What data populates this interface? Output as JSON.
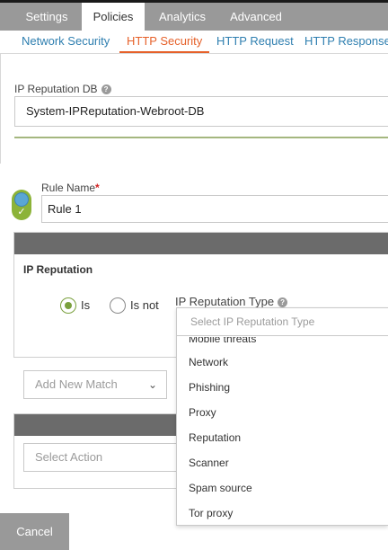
{
  "top_tabs": [
    {
      "label": "Settings",
      "active": false
    },
    {
      "label": "Policies",
      "active": true
    },
    {
      "label": "Analytics",
      "active": false
    },
    {
      "label": "Advanced",
      "active": false
    }
  ],
  "sub_tabs": [
    {
      "label": "Network Security",
      "active": false
    },
    {
      "label": "HTTP Security",
      "active": true
    },
    {
      "label": "HTTP Request",
      "active": false
    },
    {
      "label": "HTTP Response",
      "active": false
    }
  ],
  "ip_reputation_db": {
    "label": "IP Reputation DB",
    "value": "System-IPReputation-Webroot-DB"
  },
  "rule": {
    "name_label": "Rule Name",
    "required_mark": "*",
    "name_value": "Rule 1",
    "enabled": true
  },
  "ip_reputation_panel": {
    "title": "IP Reputation",
    "radio_is": "Is",
    "radio_is_not": "Is not",
    "selected": "Is",
    "type_label": "IP Reputation Type",
    "type_placeholder": "Select IP Reputation Type"
  },
  "add_new_match": {
    "placeholder": "Add New Match"
  },
  "select_action": {
    "placeholder": "Select Action"
  },
  "dropdown_options": [
    "Mobile threats",
    "Network",
    "Phishing",
    "Proxy",
    "Reputation",
    "Scanner",
    "Spam source",
    "Tor proxy"
  ],
  "footer": {
    "cancel_label": "Cancel"
  },
  "colors": {
    "accent_orange": "#e6612a",
    "link_blue": "#2f7fb0",
    "toggle_green": "#8cb338",
    "radio_green": "#7aa03d",
    "panel_header": "#6b6b6b",
    "tab_bar": "#999999"
  },
  "icons": {
    "help": "question-circle-icon",
    "chevron": "chevron-down-icon",
    "check": "check-icon"
  }
}
